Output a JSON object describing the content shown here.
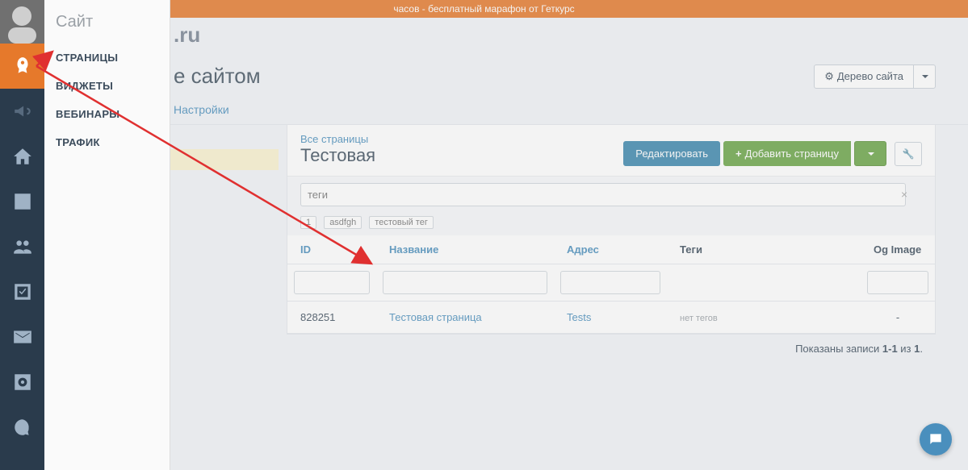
{
  "banner_text": "часов - бесплатный марафон от Геткурс",
  "site_domain": ".ru",
  "page_title": "е сайтом",
  "site_tree_button": "Дерево сайта",
  "submenu": {
    "title": "Сайт",
    "items": [
      "СТРАНИЦЫ",
      "ВИДЖЕТЫ",
      "ВЕБИНАРЫ",
      "ТРАФИК"
    ]
  },
  "tabs": {
    "settings": "Настройки"
  },
  "panel": {
    "all_pages": "Все страницы",
    "folder": "Тестовая",
    "edit": "Редактировать",
    "add_page": "Добавить страницу",
    "tags_placeholder": "теги",
    "tag_filters": [
      "1",
      "asdfgh",
      "тестовый тег"
    ]
  },
  "columns": {
    "id": "ID",
    "name": "Название",
    "url": "Адрес",
    "tags": "Теги",
    "og": "Og Image"
  },
  "rows": [
    {
      "id": "828251",
      "name": "Тестовая страница",
      "url": "Tests",
      "tags": "нет тегов",
      "og": "-"
    }
  ],
  "pagination": {
    "prefix": "Показаны записи ",
    "range": "1-1",
    "of": " из ",
    "total": "1",
    "suffix": "."
  }
}
